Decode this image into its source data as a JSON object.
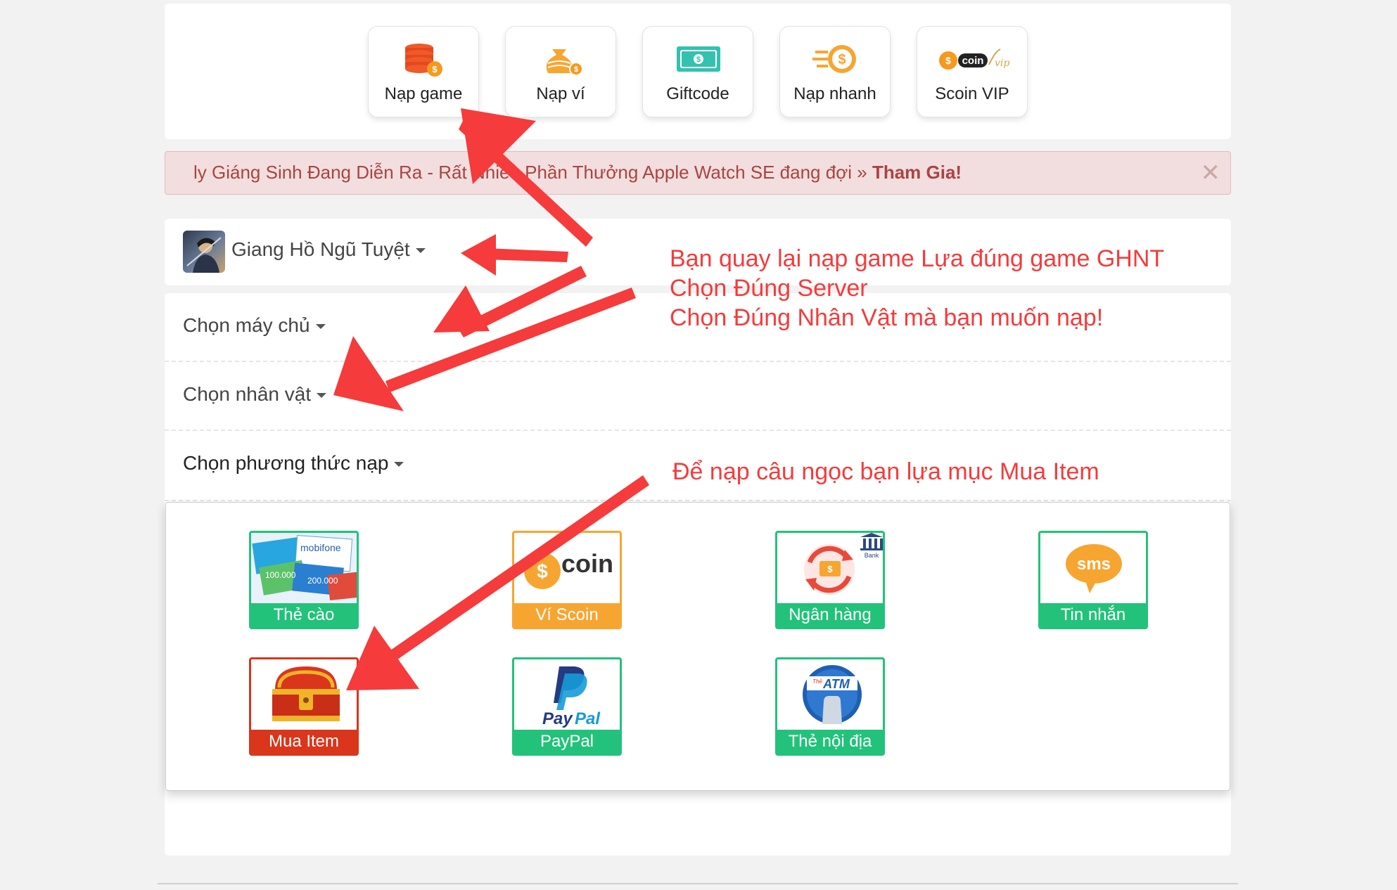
{
  "nav": {
    "items": [
      {
        "label": "Nạp game",
        "icon": "coin-stack-icon"
      },
      {
        "label": "Nạp ví",
        "icon": "money-bag-icon"
      },
      {
        "label": "Giftcode",
        "icon": "ticket-icon"
      },
      {
        "label": "Nạp nhanh",
        "icon": "fast-coin-icon"
      },
      {
        "label": "Scoin VIP",
        "icon": "scoin-vip-logo"
      }
    ]
  },
  "notice": {
    "text": "ly Giáng Sinh Đang Diễn Ra - Rất Nhiều Phần Thưởng Apple Watch SE đang đợi » ",
    "link": "Tham Gia!",
    "close": "✕"
  },
  "game": {
    "name": "Giang Hồ Ngũ Tuyệt"
  },
  "selectors": {
    "server": "Chọn máy chủ",
    "character": "Chọn nhân vật",
    "method": "Chọn phương thức nạp"
  },
  "methods": [
    {
      "label": "Thẻ cào",
      "icon": "scratch-card-icon"
    },
    {
      "label": "Ví Scoin",
      "icon": "scoin-icon"
    },
    {
      "label": "Ngân hàng",
      "icon": "bank-transfer-icon"
    },
    {
      "label": "Tin nhắn",
      "icon": "sms-icon"
    },
    {
      "label": "Mua Item",
      "icon": "treasure-chest-icon"
    },
    {
      "label": "PayPal",
      "icon": "paypal-icon"
    },
    {
      "label": "Thẻ nội địa",
      "icon": "atm-card-icon"
    }
  ],
  "annotations": {
    "line1": "Bạn quay lại nạp game Lựa đúng game GHNT",
    "line2": "Chọn Đúng Server",
    "line3": "Chọn Đúng Nhân Vật mà bạn muốn nạp!",
    "line4": "Để nạp câu ngọc bạn lựa mục Mua Item"
  },
  "colors": {
    "accent_green": "#22c27a",
    "accent_orange": "#f7a531",
    "accent_red": "#d9361c",
    "annotation_red": "#f53b3b",
    "notice_bg": "#f2dede"
  }
}
